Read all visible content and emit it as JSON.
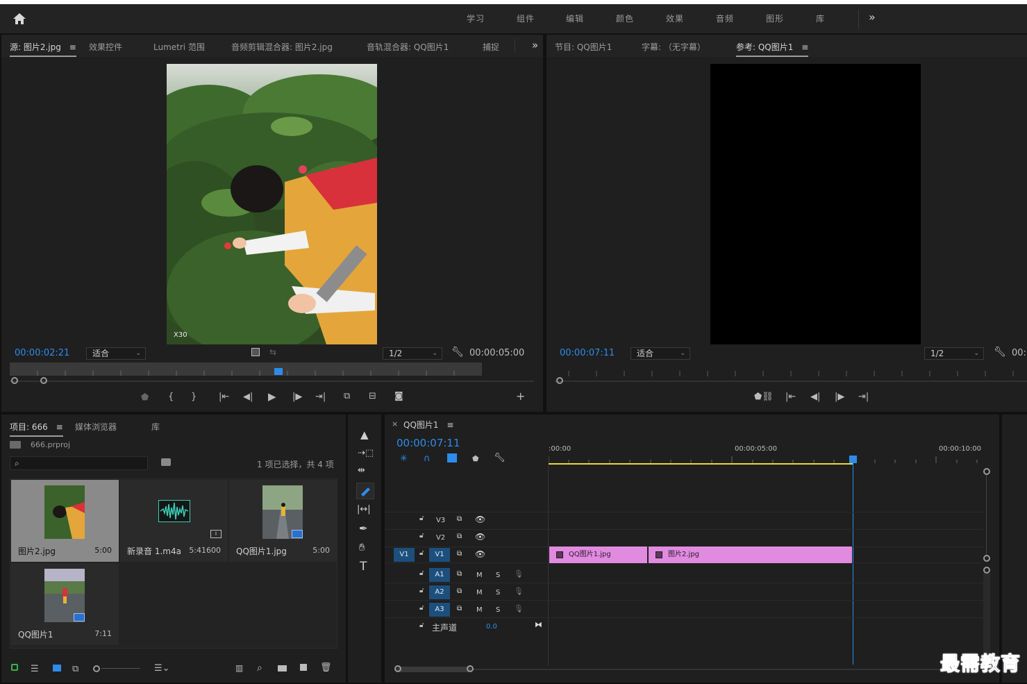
{
  "workspace": {
    "tabs": [
      "学习",
      "组件",
      "编辑",
      "颜色",
      "效果",
      "音频",
      "图形",
      "库"
    ],
    "more": "»"
  },
  "source_panel": {
    "tabs": [
      "源: 图片2.jpg",
      "效果控件",
      "Lumetri 范围",
      "音频剪辑混合器: 图片2.jpg",
      "音轨混合器: QQ图片1",
      "捕捉"
    ],
    "active_tab_menu": "≡",
    "more": "»",
    "timecode_in": "00:00:02:21",
    "fit": "适合",
    "resolution": "1/2",
    "timecode_dur": "00:00:05:00",
    "watermark": "X30"
  },
  "program_panel": {
    "tabs": [
      "节目: QQ图片1",
      "字幕: （无字幕）",
      "参考: QQ图片1"
    ],
    "active_tab_menu": "≡",
    "timecode": "00:00:07:11",
    "fit": "适合",
    "resolution": "1/2",
    "timecode_dur": "00:"
  },
  "project_panel": {
    "tabs": [
      "项目: 666",
      "媒体浏览器",
      "库"
    ],
    "active_tab_menu": "≡",
    "project_file": "666.prproj",
    "search_placeholder": "",
    "status": "1 项已选择，共 4 项",
    "items": [
      {
        "name": "图片2.jpg",
        "duration": "5:00"
      },
      {
        "name": "新录音 1.m4a",
        "duration": "5:41600"
      },
      {
        "name": "QQ图片1.jpg",
        "duration": "5:00"
      },
      {
        "name": "QQ图片1",
        "duration": "7:11"
      }
    ]
  },
  "timeline": {
    "close": "×",
    "sequence_name": "QQ图片1",
    "menu": "≡",
    "timecode": "00:00:07:11",
    "ruler": [
      ":00:00",
      "00:00:05:00",
      "00:00:10:00"
    ],
    "video_tracks": [
      {
        "name": "V3",
        "source": ""
      },
      {
        "name": "V2",
        "source": ""
      },
      {
        "name": "V1",
        "source": "V1"
      }
    ],
    "audio_tracks": [
      {
        "name": "A1",
        "m": "M",
        "s": "S"
      },
      {
        "name": "A2",
        "m": "M",
        "s": "S"
      },
      {
        "name": "A3",
        "m": "M",
        "s": "S"
      }
    ],
    "master": {
      "label": "主声道",
      "value": "0.0"
    },
    "clips": [
      {
        "name": "QQ图片1.jpg"
      },
      {
        "name": "图片2.jpg"
      }
    ]
  },
  "branding": {
    "logo_text": "最需教育"
  },
  "colors": {
    "accent": "#2d8ceb",
    "clip": "#e18be0",
    "track_btn": "#1d4f7d",
    "playhead_bar": "#e8d93a"
  }
}
